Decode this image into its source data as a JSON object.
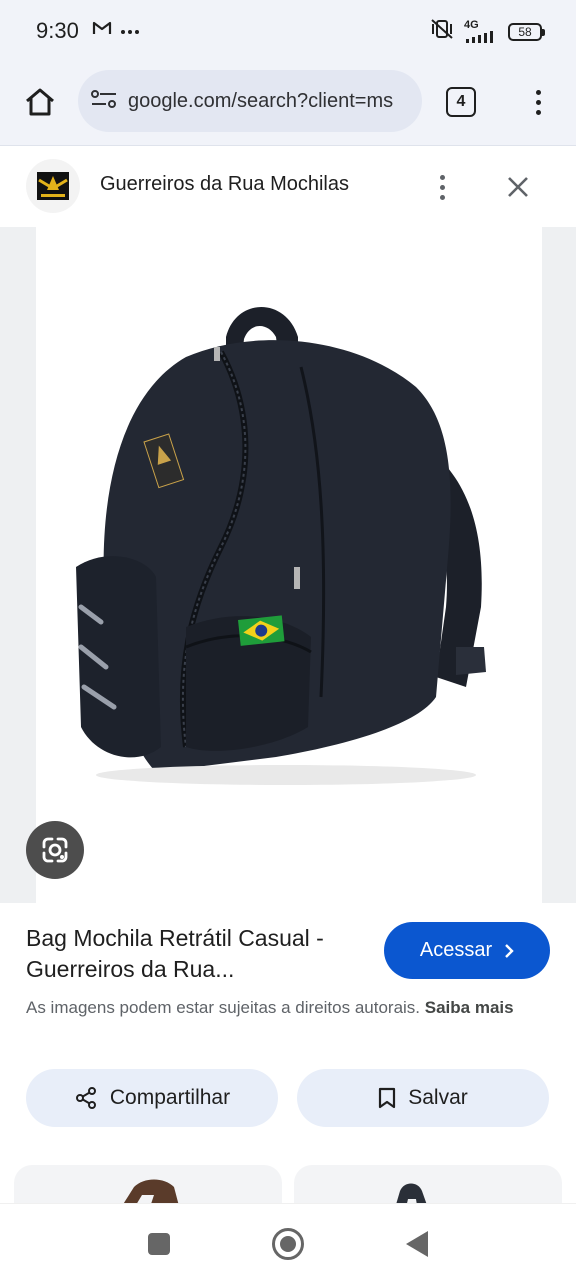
{
  "status_bar": {
    "time": "9:30",
    "network": "4G",
    "battery": "58",
    "icons": [
      "gmail-icon",
      "more-notifications-icon",
      "mute-vibrate-icon",
      "signal-icon",
      "battery-icon"
    ]
  },
  "browser": {
    "url": "google.com/search?client=ms",
    "tab_count": "4",
    "icons": [
      "home-icon",
      "site-settings-icon",
      "tab-switcher-icon",
      "overflow-menu-icon"
    ]
  },
  "sheet": {
    "site_name": "Guerreiros da Rua Mochilas",
    "icons": [
      "site-logo-icon",
      "more-vert-icon",
      "close-icon"
    ]
  },
  "result": {
    "title": "Bag Mochila Retrátil Casual - Guerreiros da Rua...",
    "visit_label": "Acessar",
    "copyright_text": "As imagens podem estar sujeitas a direitos autorais.",
    "learn_more": "Saiba mais",
    "share_label": "Compartilhar",
    "save_label": "Salvar"
  },
  "colors": {
    "accent": "#0b57d0",
    "toolbar_bg": "#f1f3f9",
    "pill_bg": "#e8eef9"
  },
  "nav": {
    "icons": [
      "recents-icon",
      "home-nav-icon",
      "back-icon"
    ]
  }
}
